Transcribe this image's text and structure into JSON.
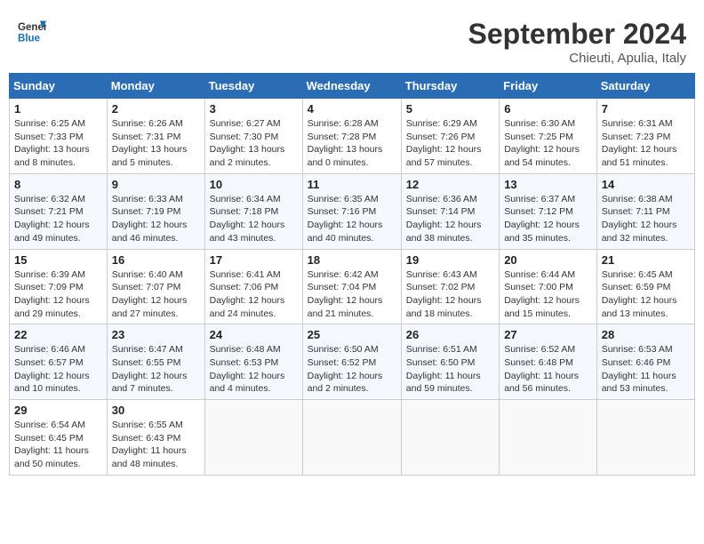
{
  "header": {
    "logo_line1": "General",
    "logo_line2": "Blue",
    "month": "September 2024",
    "location": "Chieuti, Apulia, Italy"
  },
  "weekdays": [
    "Sunday",
    "Monday",
    "Tuesday",
    "Wednesday",
    "Thursday",
    "Friday",
    "Saturday"
  ],
  "weeks": [
    [
      {
        "day": "1",
        "info": "Sunrise: 6:25 AM\nSunset: 7:33 PM\nDaylight: 13 hours\nand 8 minutes."
      },
      {
        "day": "2",
        "info": "Sunrise: 6:26 AM\nSunset: 7:31 PM\nDaylight: 13 hours\nand 5 minutes."
      },
      {
        "day": "3",
        "info": "Sunrise: 6:27 AM\nSunset: 7:30 PM\nDaylight: 13 hours\nand 2 minutes."
      },
      {
        "day": "4",
        "info": "Sunrise: 6:28 AM\nSunset: 7:28 PM\nDaylight: 13 hours\nand 0 minutes."
      },
      {
        "day": "5",
        "info": "Sunrise: 6:29 AM\nSunset: 7:26 PM\nDaylight: 12 hours\nand 57 minutes."
      },
      {
        "day": "6",
        "info": "Sunrise: 6:30 AM\nSunset: 7:25 PM\nDaylight: 12 hours\nand 54 minutes."
      },
      {
        "day": "7",
        "info": "Sunrise: 6:31 AM\nSunset: 7:23 PM\nDaylight: 12 hours\nand 51 minutes."
      }
    ],
    [
      {
        "day": "8",
        "info": "Sunrise: 6:32 AM\nSunset: 7:21 PM\nDaylight: 12 hours\nand 49 minutes."
      },
      {
        "day": "9",
        "info": "Sunrise: 6:33 AM\nSunset: 7:19 PM\nDaylight: 12 hours\nand 46 minutes."
      },
      {
        "day": "10",
        "info": "Sunrise: 6:34 AM\nSunset: 7:18 PM\nDaylight: 12 hours\nand 43 minutes."
      },
      {
        "day": "11",
        "info": "Sunrise: 6:35 AM\nSunset: 7:16 PM\nDaylight: 12 hours\nand 40 minutes."
      },
      {
        "day": "12",
        "info": "Sunrise: 6:36 AM\nSunset: 7:14 PM\nDaylight: 12 hours\nand 38 minutes."
      },
      {
        "day": "13",
        "info": "Sunrise: 6:37 AM\nSunset: 7:12 PM\nDaylight: 12 hours\nand 35 minutes."
      },
      {
        "day": "14",
        "info": "Sunrise: 6:38 AM\nSunset: 7:11 PM\nDaylight: 12 hours\nand 32 minutes."
      }
    ],
    [
      {
        "day": "15",
        "info": "Sunrise: 6:39 AM\nSunset: 7:09 PM\nDaylight: 12 hours\nand 29 minutes."
      },
      {
        "day": "16",
        "info": "Sunrise: 6:40 AM\nSunset: 7:07 PM\nDaylight: 12 hours\nand 27 minutes."
      },
      {
        "day": "17",
        "info": "Sunrise: 6:41 AM\nSunset: 7:06 PM\nDaylight: 12 hours\nand 24 minutes."
      },
      {
        "day": "18",
        "info": "Sunrise: 6:42 AM\nSunset: 7:04 PM\nDaylight: 12 hours\nand 21 minutes."
      },
      {
        "day": "19",
        "info": "Sunrise: 6:43 AM\nSunset: 7:02 PM\nDaylight: 12 hours\nand 18 minutes."
      },
      {
        "day": "20",
        "info": "Sunrise: 6:44 AM\nSunset: 7:00 PM\nDaylight: 12 hours\nand 15 minutes."
      },
      {
        "day": "21",
        "info": "Sunrise: 6:45 AM\nSunset: 6:59 PM\nDaylight: 12 hours\nand 13 minutes."
      }
    ],
    [
      {
        "day": "22",
        "info": "Sunrise: 6:46 AM\nSunset: 6:57 PM\nDaylight: 12 hours\nand 10 minutes."
      },
      {
        "day": "23",
        "info": "Sunrise: 6:47 AM\nSunset: 6:55 PM\nDaylight: 12 hours\nand 7 minutes."
      },
      {
        "day": "24",
        "info": "Sunrise: 6:48 AM\nSunset: 6:53 PM\nDaylight: 12 hours\nand 4 minutes."
      },
      {
        "day": "25",
        "info": "Sunrise: 6:50 AM\nSunset: 6:52 PM\nDaylight: 12 hours\nand 2 minutes."
      },
      {
        "day": "26",
        "info": "Sunrise: 6:51 AM\nSunset: 6:50 PM\nDaylight: 11 hours\nand 59 minutes."
      },
      {
        "day": "27",
        "info": "Sunrise: 6:52 AM\nSunset: 6:48 PM\nDaylight: 11 hours\nand 56 minutes."
      },
      {
        "day": "28",
        "info": "Sunrise: 6:53 AM\nSunset: 6:46 PM\nDaylight: 11 hours\nand 53 minutes."
      }
    ],
    [
      {
        "day": "29",
        "info": "Sunrise: 6:54 AM\nSunset: 6:45 PM\nDaylight: 11 hours\nand 50 minutes."
      },
      {
        "day": "30",
        "info": "Sunrise: 6:55 AM\nSunset: 6:43 PM\nDaylight: 11 hours\nand 48 minutes."
      },
      null,
      null,
      null,
      null,
      null
    ]
  ]
}
